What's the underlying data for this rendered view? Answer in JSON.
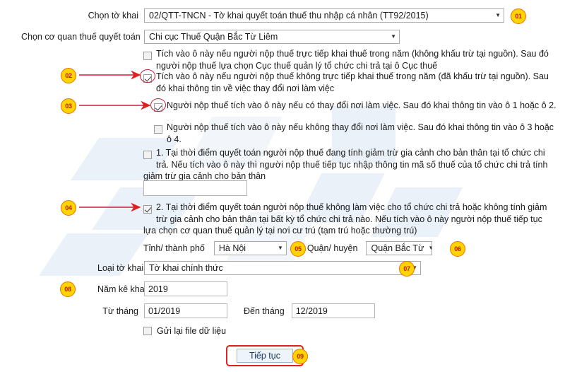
{
  "form": {
    "declaration_label": "Chọn tờ khai",
    "declaration_value": "02/QTT-TNCN - Tờ khai quyết toán thuế thu nhập cá nhân (TT92/2015)",
    "tax_office_label": "Chọn cơ quan thuế quyết toán",
    "tax_office_value": "Chi cục Thuế Quận Bắc Từ Liêm",
    "province_label": "Tỉnh/ thành phố",
    "province_value": "Hà Nội",
    "district_label": "Quận/ huyện",
    "district_value": "Quận Bắc Từ",
    "declaration_type_label": "Loại tờ khai",
    "declaration_type_value": "Tờ khai chính thức",
    "year_label": "Năm kê khai",
    "year_value": "2019",
    "from_month_label": "Từ tháng",
    "from_month_value": "01/2019",
    "to_month_label": "Đến tháng",
    "to_month_value": "12/2019",
    "tax_code_value": "",
    "resend_file_label": "Gửi lại file dữ liệu",
    "continue_label": "Tiếp tục"
  },
  "options": [
    {
      "id": "opt-direct",
      "checked": false,
      "ringed": false,
      "text": "Tích vào ô này nếu người nộp thuế trực tiếp khai thuế trong năm (không khấu trừ tại nguồn). Sau đó người nộp thuế lựa chọn Cục thuế quản lý tổ chức chi trả tại ô Cục thuế"
    },
    {
      "id": "opt-indirect",
      "checked": true,
      "ringed": true,
      "text": "Tích vào ô này nếu người nộp thuế không trực tiếp khai thuế trong năm (đã khấu trừ tại nguồn). Sau đó khai thông tin về việc thay đổi nơi làm việc"
    },
    {
      "id": "opt-changed-workplace",
      "checked": true,
      "ringed": true,
      "text": "Người nộp thuế tích vào ô này nếu có thay đổi nơi làm việc. Sau đó khai thông tin vào ô 1 hoặc ô 2."
    },
    {
      "id": "opt-unchanged-workplace",
      "checked": false,
      "ringed": false,
      "text": "Người nộp thuế tích vào ô này nếu không thay đổi nơi làm việc. Sau đó khai thông tin vào ô 3 hoặc ô 4."
    },
    {
      "id": "opt-case-1",
      "checked": false,
      "ringed": false,
      "text": "1. Tại thời điểm quyết toán người nộp thuế đang tính giảm trừ gia cảnh cho bản thân tại tổ chức chi trả. Nếu tích vào ô này thì người nộp thuế tiếp tục nhập thông tin mã số thuế của tổ chức chi trả tính giảm trừ gia cảnh cho bản thân"
    },
    {
      "id": "opt-case-2",
      "checked": true,
      "ringed": false,
      "text": "2. Tại thời điểm quyết toán người nộp thuế không làm việc cho tổ chức chi trả hoặc không tính giảm trừ gia cảnh cho bản thân tại bất kỳ tổ chức chi trả nào. Nếu tích vào ô này người nộp thuế tiếp tục lựa chọn cơ quan thuế quản lý tại nơi cư trú (tạm trú hoặc thường trú)"
    }
  ],
  "badges": [
    {
      "id": "badge-01",
      "label": "01"
    },
    {
      "id": "badge-02",
      "label": "02"
    },
    {
      "id": "badge-03",
      "label": "03"
    },
    {
      "id": "badge-04",
      "label": "04"
    },
    {
      "id": "badge-05",
      "label": "05"
    },
    {
      "id": "badge-06",
      "label": "06"
    },
    {
      "id": "badge-07",
      "label": "07"
    },
    {
      "id": "badge-08",
      "label": "08"
    },
    {
      "id": "badge-09",
      "label": "09"
    }
  ],
  "colors": {
    "badge_fill": "#ffd400",
    "badge_border": "#f07000",
    "badge_text": "#c01800",
    "annotation_red": "#d01c3a",
    "highlight_red": "#e02020",
    "watermark_blue": "#eaf1f8"
  }
}
